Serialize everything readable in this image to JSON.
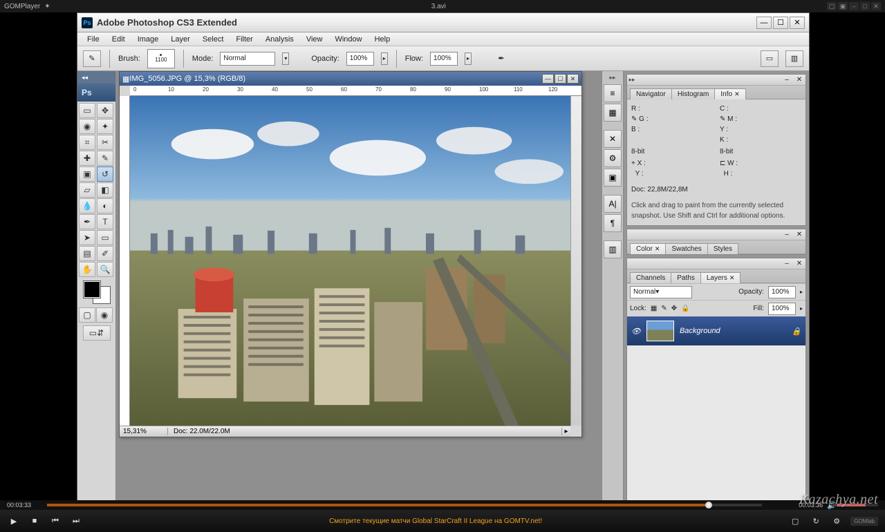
{
  "gom": {
    "player_name": "GOMPlayer",
    "filename": "3.avi",
    "time_current": "00:03:33",
    "time_total": "00:03:36",
    "marquee": "Смотрите текущие матчи Global StarCraft II League на GOMTV.net!",
    "brand_tag": "GOMlab"
  },
  "ps": {
    "title": "Adobe Photoshop CS3 Extended",
    "menu": [
      "File",
      "Edit",
      "Image",
      "Layer",
      "Select",
      "Filter",
      "Analysis",
      "View",
      "Window",
      "Help"
    ],
    "options": {
      "brush_label": "Brush:",
      "brush_size": "1100",
      "mode_label": "Mode:",
      "mode_value": "Normal",
      "opacity_label": "Opacity:",
      "opacity_value": "100%",
      "flow_label": "Flow:",
      "flow_value": "100%"
    },
    "doc": {
      "title": "IMG_5056.JPG @ 15,3% (RGB/8)",
      "zoom": "15,31%",
      "status": "Doc: 22.0M/22.0M",
      "ruler_marks": [
        "0",
        "10",
        "20",
        "30",
        "40",
        "50",
        "60",
        "70",
        "80",
        "90",
        "100",
        "110",
        "120"
      ]
    },
    "info_panel": {
      "tabs": [
        "Navigator",
        "Histogram",
        "Info"
      ],
      "rgb": {
        "r": "R :",
        "g": "G :",
        "b": "B :"
      },
      "cmyk": {
        "c": "C :",
        "m": "M :",
        "y": "Y :",
        "k": "K :"
      },
      "bit": "8-bit",
      "bit2": "8-bit",
      "xy": {
        "x": "X :",
        "y": "Y :"
      },
      "wh": {
        "w": "W :",
        "h": "H :"
      },
      "doc_line": "Doc: 22,8M/22,8M",
      "hint": "Click and drag to paint from the currently selected snapshot.  Use Shift and Ctrl for additional options."
    },
    "color_panel": {
      "tabs": [
        "Color",
        "Swatches",
        "Styles"
      ]
    },
    "layers_panel": {
      "tabs": [
        "Channels",
        "Paths",
        "Layers"
      ],
      "blend": "Normal",
      "opacity_lbl": "Opacity:",
      "opacity": "100%",
      "lock_lbl": "Lock:",
      "fill_lbl": "Fill:",
      "fill": "100%",
      "layer_name": "Background"
    }
  },
  "watermark": "Kazachya.net"
}
